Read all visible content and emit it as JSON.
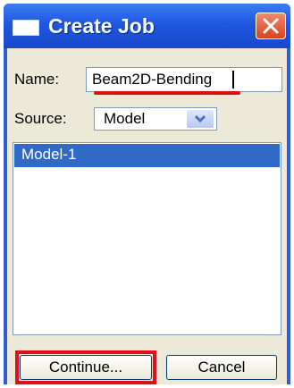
{
  "window": {
    "title": "Create Job",
    "icon": "window-icon",
    "close_icon": "close-icon"
  },
  "form": {
    "name_label": "Name:",
    "name_value": "Beam2D-Bending",
    "source_label": "Source:",
    "source_value": "Model",
    "models": [
      "Model-1"
    ]
  },
  "buttons": {
    "continue": "Continue...",
    "cancel": "Cancel"
  },
  "colors": {
    "titlebar": "#1f57e0",
    "selection": "#316ac5",
    "highlight": "#e0101a"
  }
}
